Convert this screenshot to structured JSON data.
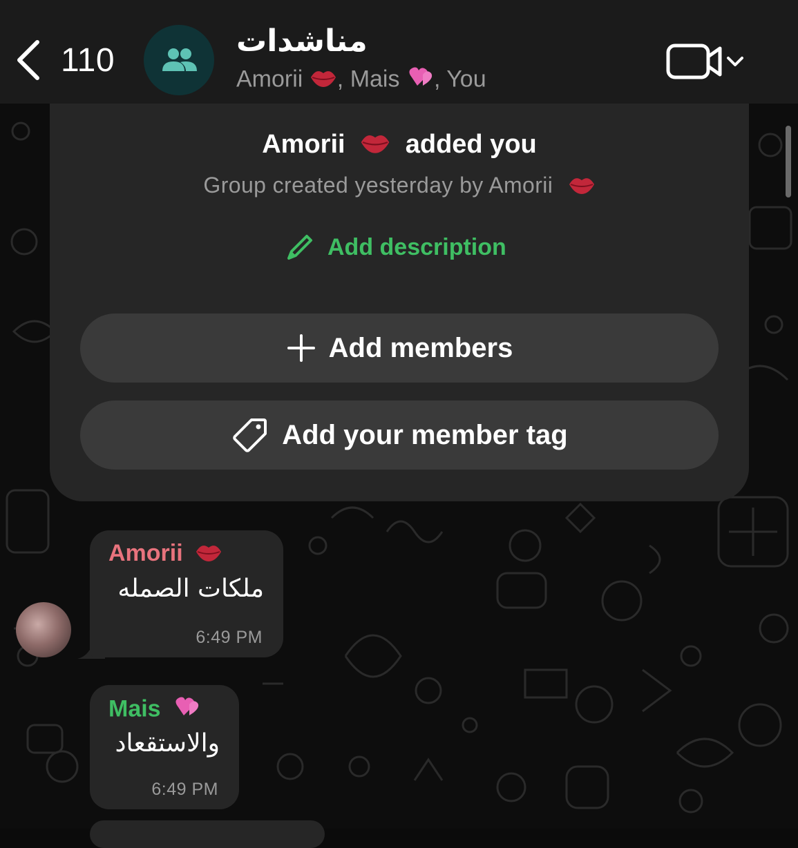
{
  "header": {
    "back_count": "110",
    "title": "مناشدات",
    "subtitle_members": [
      {
        "name": "Amorii",
        "emoji": "lips"
      },
      {
        "name": "Mais",
        "emoji": "two-hearts"
      },
      {
        "name": "You",
        "emoji": ""
      }
    ],
    "subtitle_sep": ","
  },
  "system": {
    "added_name": "Amorii",
    "added_text": "added you",
    "created_text": "Group created yesterday by Amorii",
    "add_description": "Add description",
    "add_members": "Add members",
    "add_member_tag": "Add your member tag"
  },
  "messages": [
    {
      "sender": "Amorii",
      "sender_color": "#e8737d",
      "emoji": "lips",
      "text": "ملكات الصمله",
      "time": "6:49 PM"
    },
    {
      "sender": "Mais",
      "sender_color": "#3fbe63",
      "emoji": "two-hearts",
      "text": "والاستقعاد",
      "time": "6:49 PM"
    }
  ],
  "colors": {
    "accent_green": "#3fbe63",
    "header_bg": "#1b1b1b",
    "card_bg": "#262626",
    "pill_bg": "#3a3a3a",
    "muted": "#9a9a9a",
    "group_avatar_bg": "#0f3336",
    "group_avatar_icon": "#5ec2b4"
  },
  "icons": {
    "back": "chevron-left-icon",
    "group": "group-people-icon",
    "video": "video-camera-icon",
    "dropdown": "chevron-down-icon",
    "pencil": "pencil-icon",
    "plus": "plus-icon",
    "tag": "tag-icon"
  }
}
